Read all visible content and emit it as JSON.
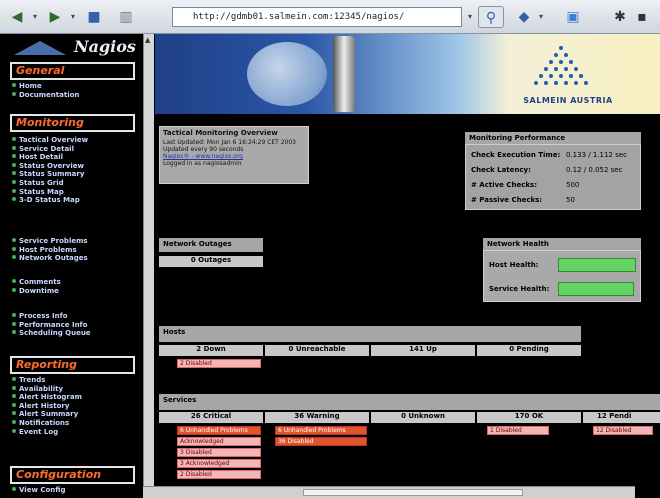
{
  "browser": {
    "url": "http://gdmb01.salmein.com:12345/nagios/",
    "icons": [
      "back-icon",
      "forward-icon",
      "stop-icon",
      "reload-icon",
      "home-icon",
      "search-icon"
    ]
  },
  "sidebar": {
    "logo_text": "Nagios",
    "sections": [
      {
        "title": "General",
        "items": [
          "Home",
          "Documentation"
        ]
      },
      {
        "title": "Monitoring",
        "groups": [
          [
            "Tactical Overview",
            "Service Detail",
            "Host Detail",
            "Status Overview",
            "Status Summary",
            "Status Grid",
            "Status Map",
            "3-D Status Map"
          ],
          [
            "Service Problems",
            "Host Problems",
            "Network Outages"
          ],
          [
            "Comments",
            "Downtime"
          ],
          [
            "Process Info",
            "Performance Info",
            "Scheduling Queue"
          ]
        ]
      },
      {
        "title": "Reporting",
        "items": [
          "Trends",
          "Availability",
          "Alert Histogram",
          "Alert History",
          "Alert Summary",
          "Notifications",
          "Event Log"
        ]
      },
      {
        "title": "Configuration",
        "items": [
          "View Config"
        ]
      }
    ]
  },
  "banner": {
    "brand": "SALMEIN AUSTRIA"
  },
  "tactical": {
    "title": "Tactical Monitoring Overview",
    "lines": [
      "Last Updated: Mon Jan 6 16:24:29 CET 2003",
      "Updated every 90 seconds",
      "Nagios® - www.nagios.org",
      "Logged in as nagiosadmin"
    ]
  },
  "performance": {
    "title": "Monitoring Performance",
    "rows": [
      {
        "label": "Check Execution Time:",
        "value": "0.133 / 1.112 sec"
      },
      {
        "label": "Check Latency:",
        "value": "0.12 / 0.052 sec"
      },
      {
        "label": "# Active Checks:",
        "value": "500"
      },
      {
        "label": "# Passive Checks:",
        "value": "50"
      }
    ]
  },
  "outages": {
    "title": "Network Outages",
    "value": "0 Outages"
  },
  "health": {
    "title": "Network Health",
    "rows": [
      {
        "label": "Host Health:",
        "level": 1.0
      },
      {
        "label": "Service Health:",
        "level": 0.97
      }
    ]
  },
  "hosts": {
    "title": "Hosts",
    "columns": [
      "2 Down",
      "0 Unreachable",
      "141 Up",
      "0 Pending"
    ],
    "items": [
      "2 Disabled"
    ]
  },
  "services": {
    "title": "Services",
    "columns": [
      "26 Critical",
      "36 Warning",
      "0 Unknown",
      "170 OK",
      "12 Pendi"
    ],
    "critical_items": [
      "6 Unhandled Problems",
      "Acknowledged",
      "3 Disabled",
      "3 Acknowledged",
      "2 Disabled"
    ],
    "warning_items": [
      "6 Unhandled Problems",
      "36 Disabled"
    ],
    "ok_items": [
      "1 Disabled"
    ],
    "pending_items": [
      "12 Disabled"
    ]
  }
}
